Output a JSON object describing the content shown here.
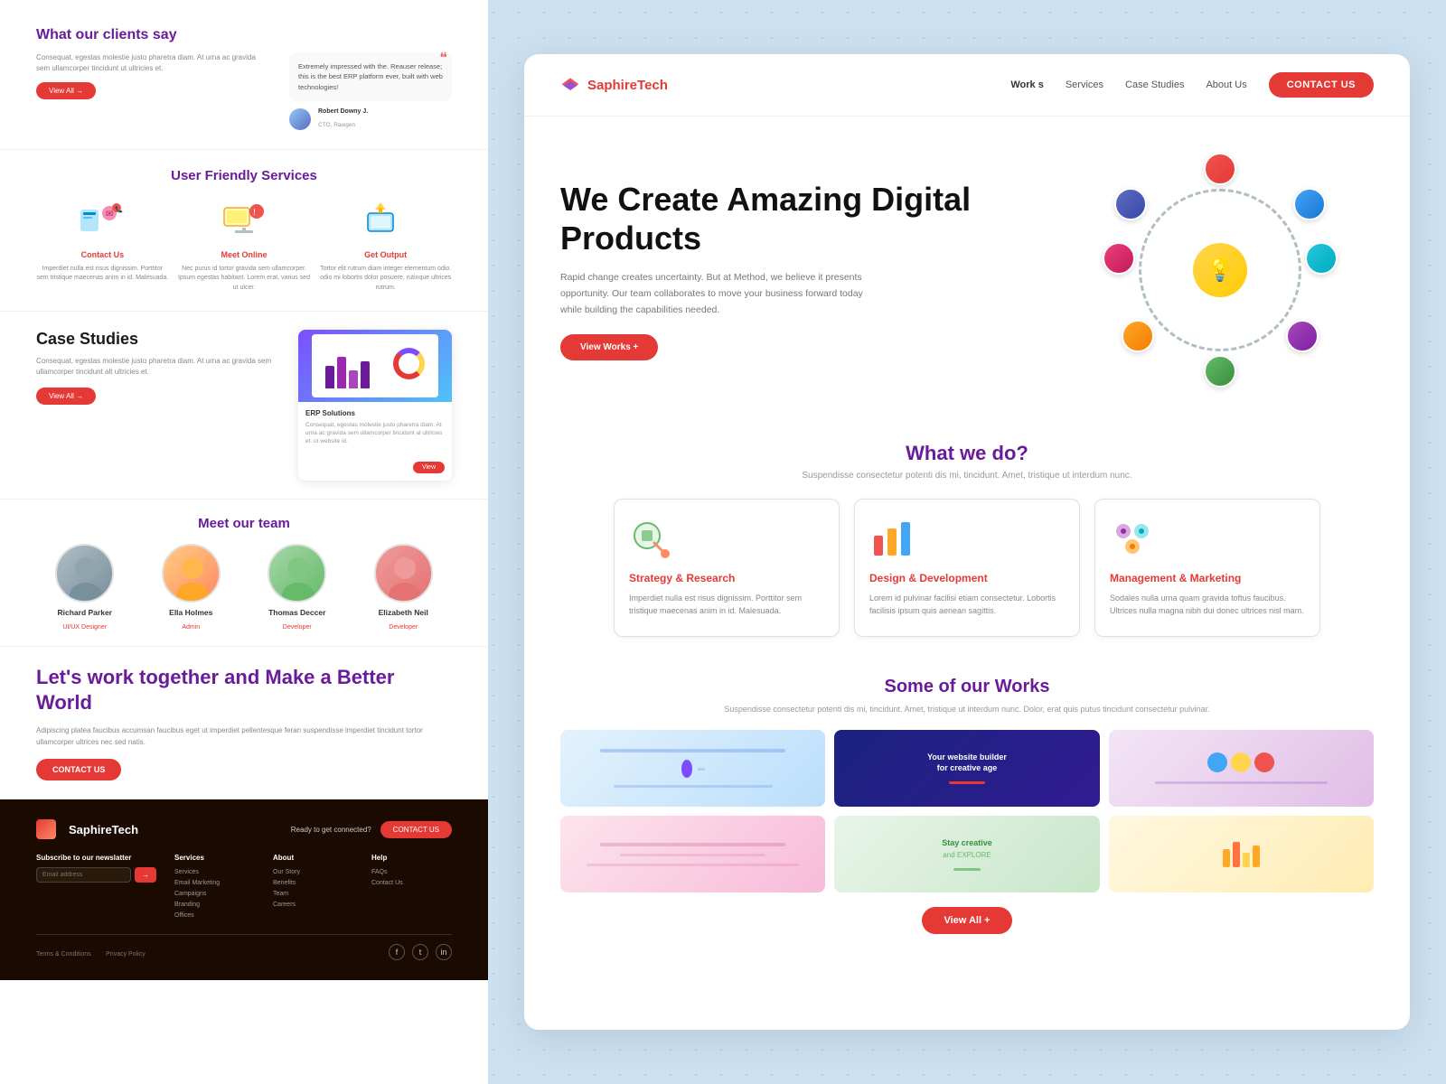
{
  "left": {
    "clients": {
      "title": "What our clients say",
      "body_text": "Consequat, egestas molestie justo pharetra diam. At urna ac gravida sem ullamcorper tincidunt ut ultricies et.",
      "btn_label": "View All →",
      "quote": "Extremely impressed with the. Reauser release; this is the best ERP platform ever, built with web technologies!",
      "reviewer_name": "Robert Downy J.",
      "reviewer_role": "CTO, Rawgen"
    },
    "services": {
      "title": "User Friendly Services",
      "items": [
        {
          "name": "Contact Us",
          "icon": "📞",
          "desc": "Imperdiet nulla est risus dignissim. Porttitor sem tristique maecenas anim in id. Malesuada."
        },
        {
          "name": "Meet Online",
          "icon": "💻",
          "desc": "Nec purus id tortor gravida sem ullamcorper. Ipsum egestas habitant. Lorem erat, varius sed ut ulcer."
        },
        {
          "name": "Get Output",
          "icon": "📤",
          "desc": "Tortor elit rutrum diam integer elementum odio. odio mi lobortis dolor posuere, rutinque ultrices rutrum."
        }
      ]
    },
    "case_studies": {
      "title": "Case Studies",
      "body_text": "Consequat, egestas molestie justo pharetra diam. At urna ac gravida sem ullamcorper tincidunt alt ultricies et.",
      "btn_label": "View All →",
      "card_title": "ERP Solutions",
      "card_text": "Consequat, egestas molestie justo pharetra diam. At urna ac gravida sem ullamcorper tincidunt al ultricies et. ut website id.",
      "card_btn": "View"
    },
    "team": {
      "title": "Meet our team",
      "members": [
        {
          "name": "Richard Parker",
          "role": "UI/UX Designer"
        },
        {
          "name": "Ella Holmes",
          "role": "Admin"
        },
        {
          "name": "Thomas Deccer",
          "role": "Developer"
        },
        {
          "name": "Elizabeth Neil",
          "role": "Developer"
        }
      ]
    },
    "cta": {
      "title": "Let's work together and Make a Better World",
      "body_text": "Adipiscing platea faucibus accumsan faucibus eget ut imperdiet pellentesque feran suspendisse imperdiet tincidunt tortor ullamcorper ultrices nec sed natis.",
      "btn_label": "CONTACT US"
    },
    "footer": {
      "logo_text": "SaphireTech",
      "ready_text": "Ready to get connected?",
      "contact_btn": "CONTACT US",
      "subscribe_title": "Subscribe to our newslatter",
      "email_placeholder": "Email address",
      "links_col1": {
        "title": "Services",
        "items": [
          "Services",
          "Email Marketing",
          "Campaigns",
          "Branding",
          "Offices"
        ]
      },
      "links_col2": {
        "title": "About",
        "items": [
          "Our Story",
          "Benefits",
          "Team",
          "Careers"
        ]
      },
      "links_col3": {
        "title": "Help",
        "items": [
          "FAQs",
          "Contact Us"
        ]
      },
      "terms": "Terms & Conditions",
      "privacy": "Privacy Policy"
    }
  },
  "right": {
    "nav": {
      "brand": "SaphireTech",
      "links": [
        "Work s",
        "Services",
        "Case Studies",
        "About Us"
      ],
      "contact_btn": "CONTACT US"
    },
    "hero": {
      "title": "We Create Amazing Digital Products",
      "body_text": "Rapid change creates uncertainty. But at Method, we believe it presents opportunity. Our team collaborates to move your business forward today while building the capabilities needed.",
      "btn_label": "View Works +"
    },
    "what_we_do": {
      "title": "What we do?",
      "subtitle": "Suspendisse consectetur potenti dis mi, tincidunt. Amet, tristique ut interdum nunc.",
      "cards": [
        {
          "title": "Strategy & Research",
          "icon": "⚙️",
          "desc": "Imperdiet nulla est risus dignissim. Porttitor sem tristique maecenas anim in id. Malesuada."
        },
        {
          "title": "Design & Development",
          "icon": "🎨",
          "desc": "Lorem id pulvinar facilisi etiam consectetur. Lobortis facilisis ipsum quis aenean sagittis."
        },
        {
          "title": "Management & Marketing",
          "icon": "📊",
          "desc": "Sodales nulla urna quam gravida toftus faucibus. Ultrices nulla magna nibh dui donec ultrices nisl mam."
        }
      ]
    },
    "some_works": {
      "title": "Some of our Works",
      "subtitle": "Suspendisse consectetur potenti dis mi, tincidunt. Amet, tristique ut interdum nunc. Dolor, erat quis putus tincidunt consectetur pulvinar.",
      "btn_label": "View All +"
    }
  }
}
